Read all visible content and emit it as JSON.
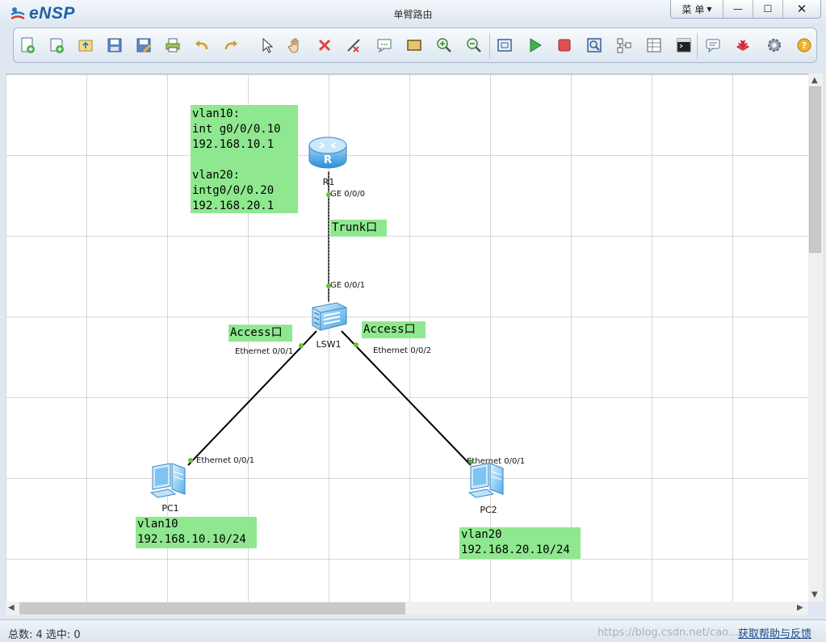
{
  "app": {
    "name": "eNSP",
    "window_title": "单臂路由"
  },
  "window_buttons": {
    "menu": "菜 单",
    "minimize": "—",
    "maximize": "☐",
    "close": "✕"
  },
  "toolbar": {
    "icons": [
      "new-topology",
      "new-template",
      "open",
      "save",
      "save-as",
      "print",
      "undo",
      "redo",
      "select",
      "pan",
      "delete",
      "delete-link",
      "text-note",
      "rectangle",
      "zoom-in",
      "zoom-out",
      "fit",
      "start-device",
      "stop-device",
      "capture",
      "topology",
      "table",
      "console",
      "chat",
      "huawei",
      "settings",
      "help"
    ]
  },
  "topology": {
    "devices": {
      "r1": {
        "label": "R1",
        "type": "router"
      },
      "lsw1": {
        "label": "LSW1",
        "type": "switch"
      },
      "pc1": {
        "label": "PC1",
        "type": "pc"
      },
      "pc2": {
        "label": "PC2",
        "type": "pc"
      }
    },
    "ports": {
      "r1_port": "GE 0/0/0",
      "lsw1_up": "GE 0/0/1",
      "lsw1_p1": "Ethernet 0/0/1",
      "lsw1_p2": "Ethernet 0/0/2",
      "pc1_port": "Ethernet 0/0/1",
      "pc2_port": "Ethernet 0/0/1"
    },
    "notes": {
      "r1_config": "vlan10:\nint g0/0/0.10\n192.168.10.1\n\nvlan20:\nintg0/0/0.20\n192.168.20.1",
      "trunk": "Trunk口",
      "access_left": "Access口",
      "access_right": "Access口",
      "pc1_info": "vlan10\n192.168.10.10/24",
      "pc2_info": "vlan20\n192.168.20.10/24"
    }
  },
  "status": {
    "left": "总数: 4 选中: 0",
    "right": "获取帮助与反馈",
    "watermark": "https://blog.csdn.net/cao..."
  },
  "colors": {
    "note_bg": "#8fe88f",
    "port_dot": "#6cc13a",
    "link": "#000000",
    "title_blue": "#1f5fa8"
  }
}
